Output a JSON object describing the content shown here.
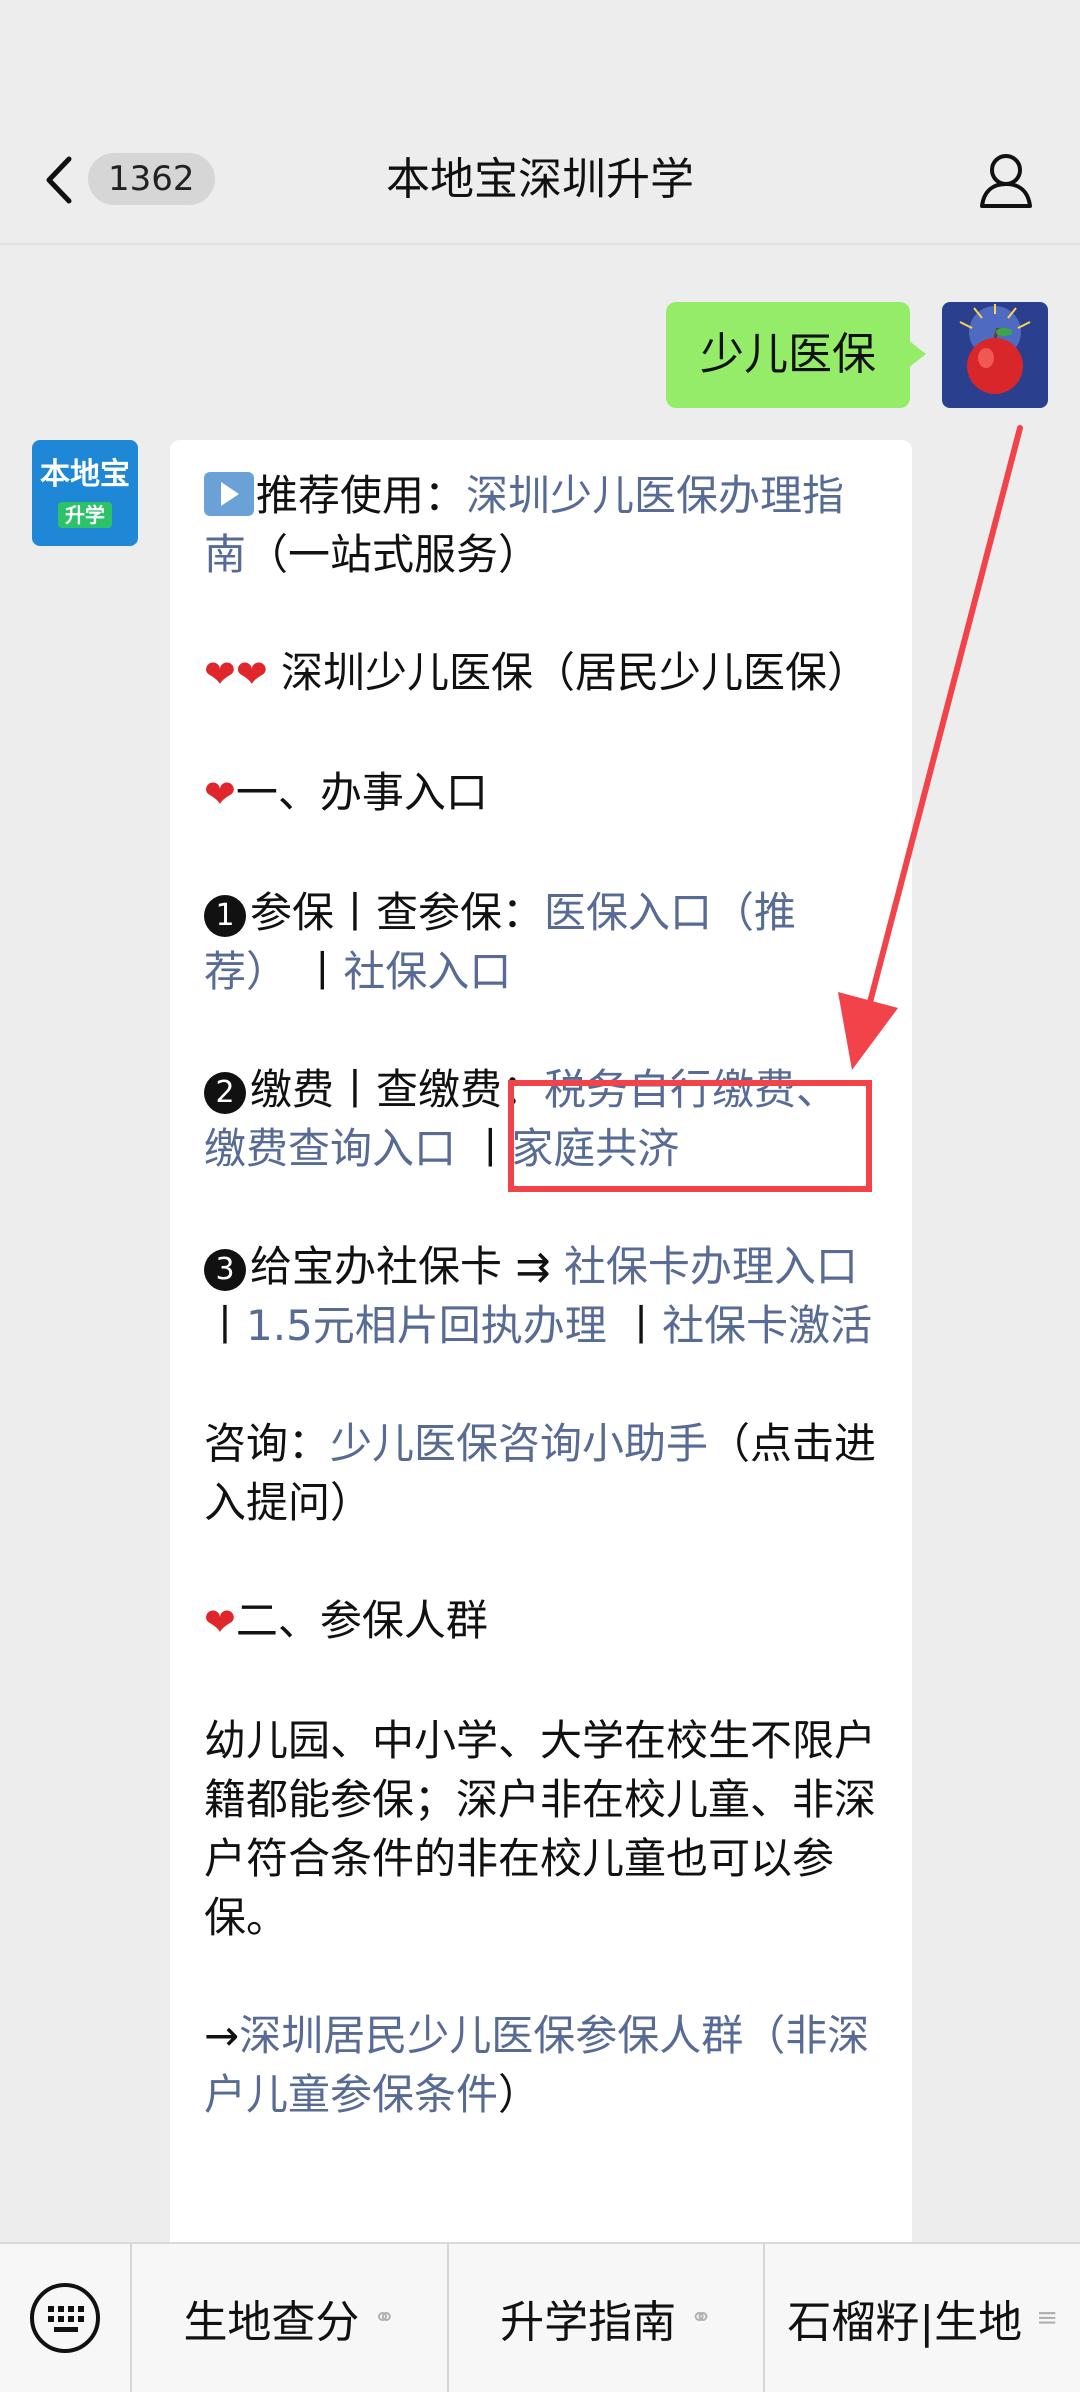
{
  "header": {
    "unread_count": "1362",
    "title": "本地宝深圳升学"
  },
  "me": {
    "message": "少儿医保"
  },
  "reply": {
    "p1_prefix": "推荐使用：",
    "p1_link": "深圳少儿医保办理指南",
    "p1_suffix": "（一站式服务）",
    "p2_text": " 深圳少儿医保（居民少儿医保）",
    "h1": "一、办事入口",
    "item1_num": "1",
    "item1_text": "参保丨查参保：",
    "item1_link1": "医保入口（推荐）",
    "item1_sep": " 丨",
    "item1_link2": "社保入口",
    "item2_num": "2",
    "item2_text": "缴费丨查缴费：",
    "item2_link1": "税务自行缴费、缴费查询入口",
    "item2_sep": " 丨",
    "item2_link2": "家庭共济",
    "item3_num": "3",
    "item3_text": "给宝办社保卡 ⇉ ",
    "item3_link1": "社保卡办理入口",
    "item3_sep1": " 丨",
    "item3_link2": "1.5元相片回执办理",
    "item3_sep2": " 丨",
    "item3_link3": "社保卡激活",
    "consult_prefix": "咨询：",
    "consult_link": "少儿医保咨询小助手",
    "consult_suffix": "（点击进入提问）",
    "h2": "二、参保人群",
    "body": "幼儿园、中小学、大学在校生不限户籍都能参保；深户非在校儿童、非深户符合条件的非在校儿童也可以参保。",
    "last_arrow": "→",
    "last_link1": "深圳居民少儿医保参保人群",
    "last_link2": "（非深户儿童参保条件",
    "last_suffix": "）"
  },
  "menu": {
    "items": [
      "生地查分",
      "升学指南",
      "石榴籽|生地"
    ]
  },
  "colors": {
    "link": "#576b95",
    "my_bubble": "#95ec69",
    "highlight": "#f2424a"
  }
}
